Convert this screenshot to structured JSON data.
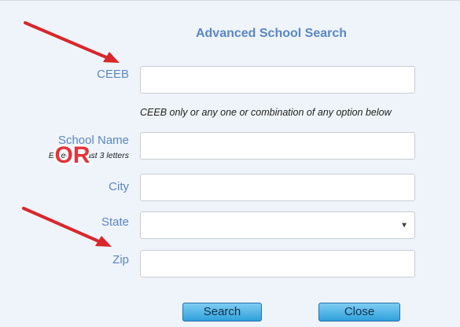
{
  "form": {
    "title": "Advanced School Search",
    "fields": {
      "ceeb": {
        "label": "CEEB",
        "value": "",
        "placeholder": ""
      },
      "school_name": {
        "label": "School Name",
        "sublabel": "Enter at least 3 letters",
        "value": "",
        "placeholder": ""
      },
      "city": {
        "label": "City",
        "value": "",
        "placeholder": ""
      },
      "state": {
        "label": "State",
        "selected": ""
      },
      "zip": {
        "label": "Zip",
        "value": "",
        "placeholder": ""
      }
    },
    "hint": "CEEB only or any one or combination of any option below",
    "buttons": {
      "search": "Search",
      "close": "Close"
    }
  },
  "annotations": {
    "or_badge_text": "OR",
    "arrow_color": "#d9262b",
    "or_badge_color": "#e8323a"
  },
  "colors": {
    "label": "#5a86c8",
    "background": "#eef4fa",
    "button_top": "#7fcdf3",
    "button_bottom": "#2fa1db"
  }
}
